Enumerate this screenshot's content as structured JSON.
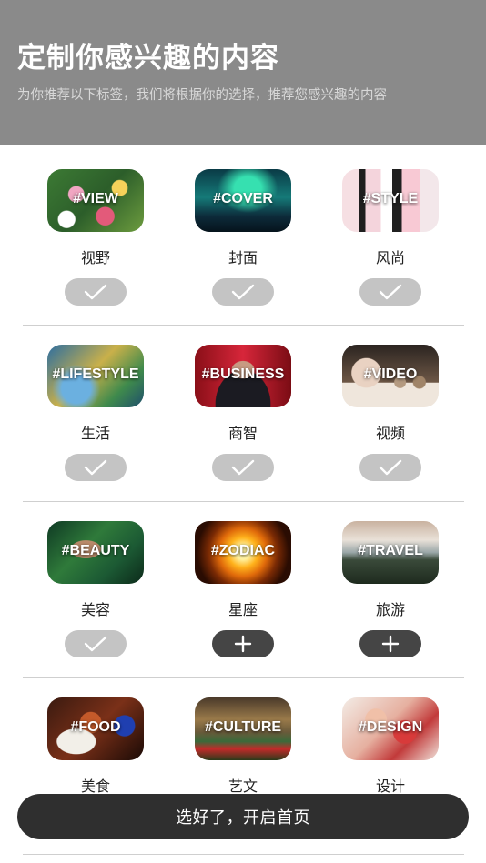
{
  "header": {
    "title": "定制你感兴趣的内容",
    "subtitle": "为你推荐以下标签，我们将根据你的选择，推荐您感兴趣的内容"
  },
  "topics": [
    [
      {
        "tag": "#VIEW",
        "name": "视野",
        "state": "selected"
      },
      {
        "tag": "#COVER",
        "name": "封面",
        "state": "selected"
      },
      {
        "tag": "#STYLE",
        "name": "风尚",
        "state": "selected"
      }
    ],
    [
      {
        "tag": "#LIFESTYLE",
        "name": "生活",
        "state": "selected"
      },
      {
        "tag": "#BUSINESS",
        "name": "商智",
        "state": "selected"
      },
      {
        "tag": "#VIDEO",
        "name": "视频",
        "state": "selected"
      }
    ],
    [
      {
        "tag": "#BEAUTY",
        "name": "美容",
        "state": "selected"
      },
      {
        "tag": "#ZODIAC",
        "name": "星座",
        "state": "unselected"
      },
      {
        "tag": "#TRAVEL",
        "name": "旅游",
        "state": "unselected"
      }
    ],
    [
      {
        "tag": "#FOOD",
        "name": "美食",
        "state": "unselected"
      },
      {
        "tag": "#CULTURE",
        "name": "艺文",
        "state": "unselected"
      },
      {
        "tag": "#DESIGN",
        "name": "设计",
        "state": "unselected"
      }
    ]
  ],
  "icons": {
    "selected": "check-icon",
    "unselected": "plus-icon"
  },
  "colors": {
    "header_bg": "#8a8a8a",
    "selected_toggle": "#c4c4c4",
    "unselected_toggle": "#454545",
    "cta_bg": "#2f2f2f"
  },
  "cta": {
    "label": "选好了，开启首页"
  }
}
